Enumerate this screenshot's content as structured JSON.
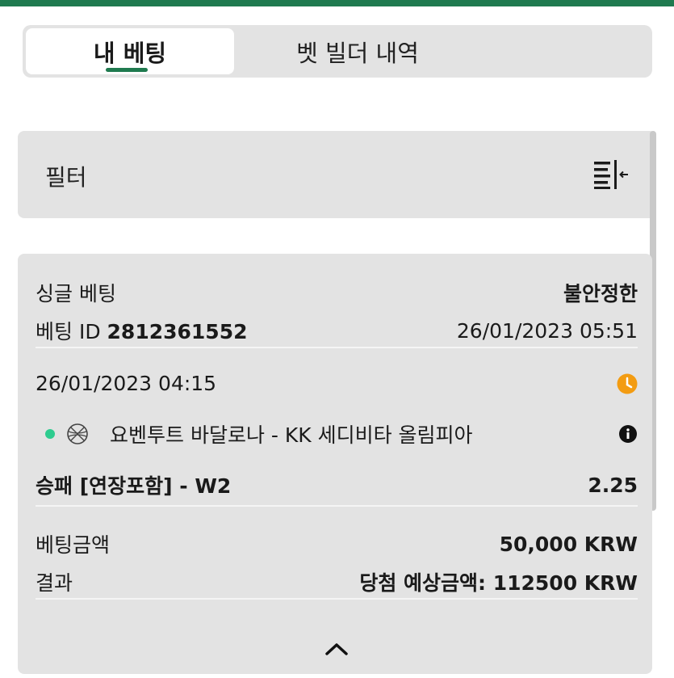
{
  "tabs": [
    {
      "label": "내 베팅",
      "active": true
    },
    {
      "label": "벳 빌더 내역",
      "active": false
    }
  ],
  "filter": {
    "label": "필터"
  },
  "bet": {
    "type_label": "싱글 베팅",
    "status": "불안정한",
    "id_label": "베팅 ID",
    "id_value": "2812361552",
    "placed_at": "26/01/2023 05:51",
    "event_time": "26/01/2023 04:15",
    "match_name": "요벤투트 바달로나 - KK 세디비타 올림피아",
    "market": "승패 [연장포함] - W2",
    "odds": "2.25",
    "stake_label": "베팅금액",
    "stake_value": "50,000 KRW",
    "result_label": "결과",
    "potential_win": "당첨 예상금액: 112500 KRW"
  },
  "icons": {
    "filter": "collapse-filter-icon",
    "clock": "clock-icon",
    "sport": "basketball-icon",
    "live": "live-dot-icon",
    "info": "info-icon",
    "chevron": "chevron-up-icon"
  },
  "colors": {
    "brand_green": "#1f7a4f",
    "live_dot": "#2ecc8f",
    "clock_orange": "#f39c12",
    "panel_bg": "#e3e3e3"
  }
}
